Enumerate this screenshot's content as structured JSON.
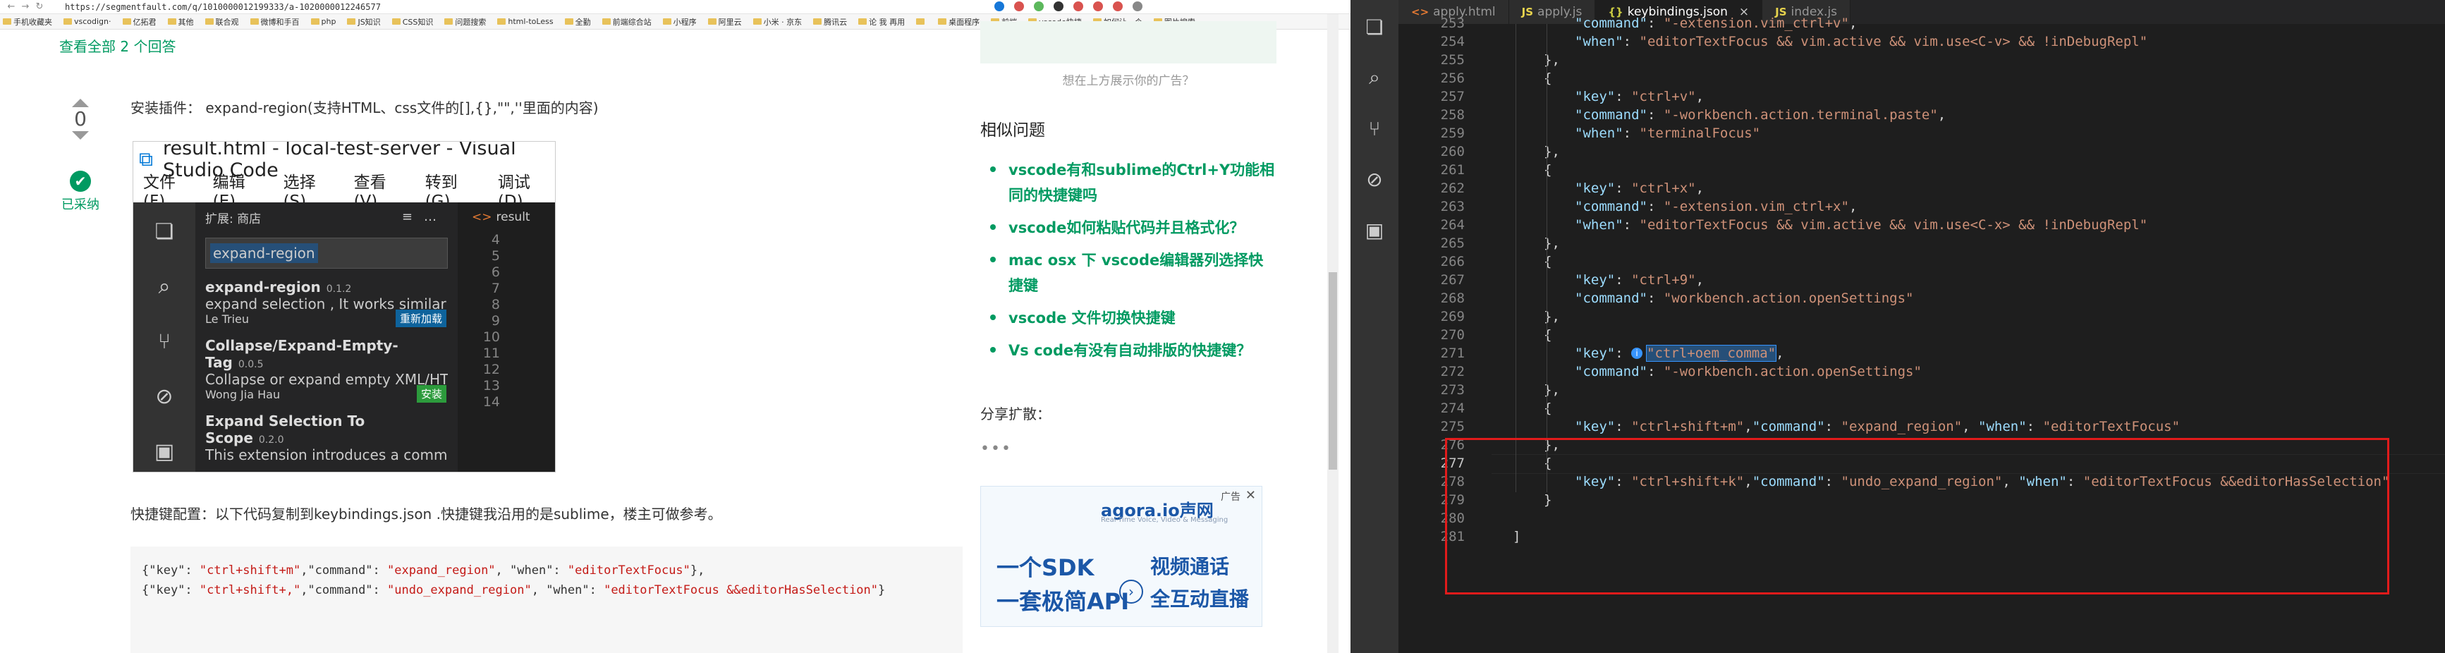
{
  "browser": {
    "url": "https://segmentfault.com/q/1010000012199333/a-1020000012246577",
    "bookmarks": [
      "手机收藏夹",
      "vscodign·",
      "亿拓君",
      "其他",
      "联合观",
      "微博和手百",
      "php",
      "JS知识",
      "CSS知识",
      "问题搜索",
      "html-toLess",
      "全勤",
      "前端综合站",
      "小程序",
      "阿里云",
      "小米 · 京东",
      "腾讯云",
      "论 我 再用",
      "",
      "桌面程序",
      "前端",
      "vscode快捷",
      "如何让一个",
      "图片搜索"
    ],
    "answers_link": "查看全部 2 个回答",
    "vote_count": "0",
    "accepted_label": "已采纳",
    "answer_intro": "安装插件： expand-region(支持HTML、css文件的[],{},\"\",''里面的内容)",
    "embedded": {
      "title": "result.html - local-test-server - Visual Studio Code",
      "menu": [
        "文件(F)",
        "编辑(E)",
        "选择(S)",
        "查看(V)",
        "转到(G)",
        "调试(D)"
      ],
      "sidebar_header": "扩展: 商店",
      "search_value": "expand-region",
      "extensions": [
        {
          "name": "expand-region",
          "version": "0.1.2",
          "desc": "expand selection , It works similar to E...",
          "author": "Le Trieu",
          "button": "重新加载"
        },
        {
          "name": "Collapse/Expand-Empty-Tag",
          "version": "0.0.5",
          "desc": "Collapse or expand empty XML/HTML...",
          "author": "Wong Jia Hau",
          "button": "安装"
        },
        {
          "name": "Expand Selection To Scope",
          "version": "0.2.0",
          "desc": "This extension introduces a command ...",
          "author": "",
          "button": ""
        }
      ],
      "editor_tab": "result",
      "line_numbers": [
        "4",
        "5",
        "6",
        "7",
        "8",
        "9",
        "10",
        "11",
        "12",
        "13",
        "14"
      ]
    },
    "shortcut_intro": "快捷键配置：以下代码复制到keybindings.json .快捷键我沿用的是sublime，楼主可做参考。",
    "code_block": [
      {
        "pre": "{\"key\": ",
        "key": "\"ctrl+shift+m\"",
        "mid": ",\"command\": ",
        "cmd": "\"expand_region\"",
        "mid2": ", \"when\": ",
        "when": "\"editorTextFocus\"",
        "post": "},"
      },
      {
        "pre": "{\"key\": ",
        "key": "\"ctrl+shift+,\"",
        "mid": ",\"command\": ",
        "cmd": "\"undo_expand_region\"",
        "mid2": ", \"when\": ",
        "when": "\"editorTextFocus &&editorHasSelection\"",
        "post": "}"
      }
    ],
    "ad_top_text": "想在上方展示你的广告？",
    "similar_title": "相似问题",
    "similar_questions": [
      "vscode有和sublime的Ctrl+Y功能相同的快捷键吗",
      "vscode如何粘贴代码并且格式化？",
      "mac osx 下 vscode编辑器列选择快捷键",
      "vscode 文件切换快捷键",
      "Vs code有没有自动排版的快捷键？"
    ],
    "share_title": "分享扩散：",
    "share_more": "•••",
    "ad_bottom": {
      "label": "广告",
      "close": "✕",
      "brand": "agora.io声网",
      "brand_sub": "Real-Time Voice, Video & Messaging",
      "line1_left": "一个SDK",
      "line2_left": "一套极简API",
      "line1_right": "视频通话",
      "line2_right": "全互动直播"
    }
  },
  "vscode": {
    "tabs": [
      {
        "icon": "<>",
        "label": "apply.html",
        "active": false
      },
      {
        "icon": "JS",
        "label": "apply.js",
        "active": false
      },
      {
        "icon": "{}",
        "label": "keybindings.json",
        "active": true,
        "close": "×"
      },
      {
        "icon": "JS",
        "label": "index.js",
        "active": false
      }
    ],
    "active_line": "277",
    "lines": [
      {
        "n": "253",
        "indent": 2,
        "key": "\"command\"",
        "val": "\"-extension.vim_ctrl+v\"",
        "trail": ","
      },
      {
        "n": "254",
        "indent": 2,
        "key": "\"when\"",
        "val": "\"editorTextFocus && vim.active && vim.use<C-v> && !inDebugRepl\"",
        "trail": ""
      },
      {
        "n": "255",
        "indent": 1,
        "raw": "},"
      },
      {
        "n": "256",
        "indent": 1,
        "raw": "{"
      },
      {
        "n": "257",
        "indent": 2,
        "key": "\"key\"",
        "val": "\"ctrl+v\"",
        "trail": ","
      },
      {
        "n": "258",
        "indent": 2,
        "key": "\"command\"",
        "val": "\"-workbench.action.terminal.paste\"",
        "trail": ","
      },
      {
        "n": "259",
        "indent": 2,
        "key": "\"when\"",
        "val": "\"terminalFocus\"",
        "trail": ""
      },
      {
        "n": "260",
        "indent": 1,
        "raw": "},"
      },
      {
        "n": "261",
        "indent": 1,
        "raw": "{"
      },
      {
        "n": "262",
        "indent": 2,
        "key": "\"key\"",
        "val": "\"ctrl+x\"",
        "trail": ","
      },
      {
        "n": "263",
        "indent": 2,
        "key": "\"command\"",
        "val": "\"-extension.vim_ctrl+x\"",
        "trail": ","
      },
      {
        "n": "264",
        "indent": 2,
        "key": "\"when\"",
        "val": "\"editorTextFocus && vim.active && vim.use<C-x> && !inDebugRepl\"",
        "trail": ""
      },
      {
        "n": "265",
        "indent": 1,
        "raw": "},"
      },
      {
        "n": "266",
        "indent": 1,
        "raw": "{"
      },
      {
        "n": "267",
        "indent": 2,
        "key": "\"key\"",
        "val": "\"ctrl+9\"",
        "trail": ","
      },
      {
        "n": "268",
        "indent": 2,
        "key": "\"command\"",
        "val": "\"workbench.action.openSettings\"",
        "trail": ""
      },
      {
        "n": "269",
        "indent": 1,
        "raw": "},"
      },
      {
        "n": "270",
        "indent": 1,
        "raw": "{"
      },
      {
        "n": "271",
        "indent": 2,
        "key": "\"key\"",
        "val": "\"ctrl+oem_comma\"",
        "trail": ",",
        "info": true
      },
      {
        "n": "272",
        "indent": 2,
        "key": "\"command\"",
        "val": "\"-workbench.action.openSettings\"",
        "trail": ""
      },
      {
        "n": "273",
        "indent": 1,
        "raw": "},"
      },
      {
        "n": "274",
        "indent": 1,
        "raw": "{"
      },
      {
        "n": "275",
        "indent": 2,
        "key": "\"key\"",
        "val": "\"ctrl+shift+m\"",
        "cmdkey": "\"command\"",
        "cmdval": "\"expand_region\"",
        "whenkey": "\"when\"",
        "whenval": "\"editorTextFocus\"",
        "inline": true
      },
      {
        "n": "276",
        "indent": 1,
        "raw": "},"
      },
      {
        "n": "277",
        "indent": 1,
        "raw": "{"
      },
      {
        "n": "278",
        "indent": 2,
        "key": "\"key\"",
        "val": "\"ctrl+shift+k\"",
        "cmdkey": "\"command\"",
        "cmdval": "\"undo_expand_region\"",
        "whenkey": "\"when\"",
        "whenval": "\"editorTextFocus &&editorHasSelection\"",
        "inline": true
      },
      {
        "n": "279",
        "indent": 1,
        "raw": "}"
      },
      {
        "n": "280",
        "indent": 0,
        "raw": ""
      },
      {
        "n": "281",
        "indent": 0,
        "raw": "]"
      }
    ]
  }
}
